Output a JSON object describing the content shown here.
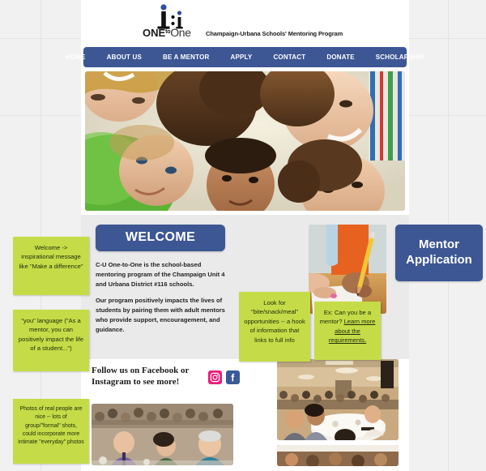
{
  "site": {
    "logo": {
      "word_one": "ONE",
      "word_to": "to",
      "word_one2": "One",
      "tagline": "Champaign-Urbana Schools' Mentoring Program",
      "icon_name": "one-to-one-logo-icon"
    },
    "nav": [
      {
        "label": "HOME"
      },
      {
        "label": "ABOUT US"
      },
      {
        "label": "BE A MENTOR"
      },
      {
        "label": "APPLY"
      },
      {
        "label": "CONTACT"
      },
      {
        "label": "DONATE"
      },
      {
        "label": "SCHOLARSHIP"
      }
    ]
  },
  "hero": {
    "alt": "Group of smiling children looking down at the camera"
  },
  "welcome": {
    "badge": "WELCOME",
    "paragraphs": [
      "C-U One-to-One is the school-based mentoring program of the Champaign Unit 4 and Urbana District #116 schools.",
      "Our program positively impacts the lives of students by pairing them with adult mentors who provide support, encouragement, and guidance."
    ]
  },
  "mid_photo": {
    "alt": "Mentor helping a student write with a pencil"
  },
  "mentor_application": {
    "label": "Mentor Application"
  },
  "follow": {
    "text": "Follow us on Facebook or Instagram to see more!",
    "social": [
      {
        "name": "instagram-icon",
        "color": "#ec1e79"
      },
      {
        "name": "facebook-icon",
        "color": "#3b5998"
      }
    ]
  },
  "bottom_photos": [
    {
      "alt": "People seated at tables during a mentoring banquet"
    },
    {
      "alt": "Wide view of a banquet hall filled with round tables of guests"
    },
    {
      "alt": "Cropped photo strip of an event"
    }
  ],
  "notes": [
    {
      "id": "note-welcome",
      "text": "Welcome -> inspirational message like \"Make a difference\""
    },
    {
      "id": "note-you",
      "text": "\"you\" language (\"As a mentor, you can positively impact the life of a student...\")"
    },
    {
      "id": "note-photos",
      "text": "Photos of real people are nice -- lots of group/\"formal\" shots, could incorporate more intimate \"everyday\" photos"
    },
    {
      "id": "note-bite",
      "text": "Look for \"bite/snack/meal\" opportunities -- a hook of information that links to full info"
    },
    {
      "id": "note-ex",
      "prefix": "Ex: Can you be a mentor? ",
      "link": "Learn more about the requirements."
    }
  ],
  "colors": {
    "brand_blue": "#3d5694",
    "note_green": "#c5dc48",
    "content_gray": "#eaeaea",
    "canvas_gray": "#f1f1f1"
  }
}
